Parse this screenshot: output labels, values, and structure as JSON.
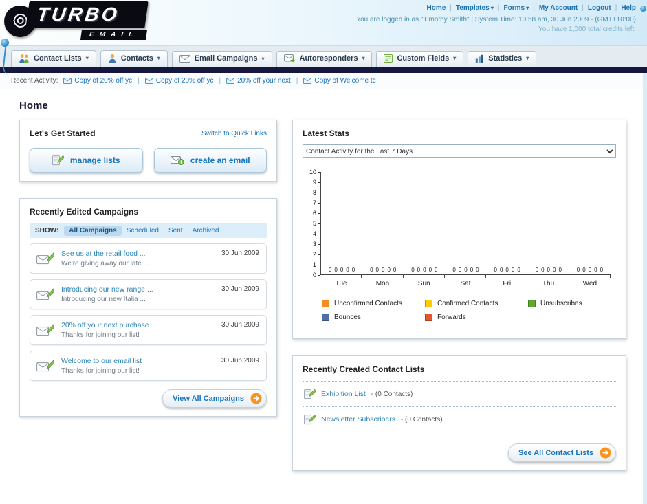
{
  "header": {
    "logo_text": "TURBO",
    "logo_sub": "EMAIL",
    "nav_links": [
      {
        "label": "Home"
      },
      {
        "label": "Templates",
        "caret": true
      },
      {
        "label": "Forms",
        "caret": true
      },
      {
        "label": "My Account"
      },
      {
        "label": "Logout"
      },
      {
        "label": "Help"
      }
    ],
    "login_info": "You are logged in as \"Timothy Smith\" | System Time: 10:58 am, 30 Jun 2009 - (GMT+10:00)",
    "credits": "You have 1,000 total credits left."
  },
  "nav_tabs": [
    {
      "label": "Contact Lists",
      "icon": "people-icon"
    },
    {
      "label": "Contacts",
      "icon": "person-icon"
    },
    {
      "label": "Email Campaigns",
      "icon": "envelope-icon"
    },
    {
      "label": "Autoresponders",
      "icon": "envelope-arrow-icon"
    },
    {
      "label": "Custom Fields",
      "icon": "form-icon"
    },
    {
      "label": "Statistics",
      "icon": "stats-icon"
    }
  ],
  "recent_activity": {
    "label": "Recent Activity:",
    "items": [
      "Copy of 20% off yc",
      "Copy of 20% off yc",
      "20% off your next",
      "Copy of Welcome tc"
    ]
  },
  "page_title": "Home",
  "get_started": {
    "title": "Let's Get Started",
    "switch_link": "Switch to Quick Links",
    "buttons": [
      {
        "label": "manage lists",
        "icon": "pencil-page-icon"
      },
      {
        "label": "create an email",
        "icon": "envelope-plus-icon"
      }
    ]
  },
  "campaigns": {
    "title": "Recently Edited Campaigns",
    "show_label": "SHOW:",
    "tabs": [
      "All Campaigns",
      "Scheduled",
      "Sent",
      "Archived"
    ],
    "items": [
      {
        "title": "See us at the retail food ...",
        "subtitle": "We're giving away our late ...",
        "date": "30 Jun 2009"
      },
      {
        "title": "Introducing our new range ...",
        "subtitle": "Introducing our new Italia ...",
        "date": "30 Jun 2009"
      },
      {
        "title": "20% off your next purchase",
        "subtitle": "Thanks for joining our list!",
        "date": "30 Jun 2009"
      },
      {
        "title": "Welcome to our email list",
        "subtitle": "Thanks for joining our list!",
        "date": "30 Jun 2009"
      }
    ],
    "view_all_label": "View All Campaigns"
  },
  "stats": {
    "title": "Latest Stats",
    "dropdown_value": "Contact Activity for the Last 7 Days"
  },
  "chart_data": {
    "type": "bar",
    "title": "Contact Activity for the Last 7 Days",
    "categories": [
      "Tue",
      "Mon",
      "Sun",
      "Sat",
      "Fri",
      "Thu",
      "Wed"
    ],
    "series": [
      {
        "name": "Unconfirmed Contacts",
        "color": "#f68b1f",
        "values": [
          0,
          0,
          0,
          0,
          0,
          0,
          0
        ]
      },
      {
        "name": "Confirmed Contacts",
        "color": "#ffcb05",
        "values": [
          0,
          0,
          0,
          0,
          0,
          0,
          0
        ]
      },
      {
        "name": "Unsubscribes",
        "color": "#61a532",
        "values": [
          0,
          0,
          0,
          0,
          0,
          0,
          0
        ]
      },
      {
        "name": "Bounces",
        "color": "#4f6fa5",
        "values": [
          0,
          0,
          0,
          0,
          0,
          0,
          0
        ]
      },
      {
        "name": "Forwards",
        "color": "#e4572e",
        "values": [
          0,
          0,
          0,
          0,
          0,
          0,
          0
        ]
      }
    ],
    "ylim": [
      0,
      10
    ],
    "yticks": [
      0,
      1,
      2,
      3,
      4,
      5,
      6,
      7,
      8,
      9,
      10
    ],
    "grid": false,
    "legend_position": "bottom"
  },
  "contact_lists": {
    "title": "Recently Created Contact Lists",
    "items": [
      {
        "name": "Exhibition List",
        "count": "(0 Contacts)"
      },
      {
        "name": "Newsletter Subscribers",
        "count": "(0 Contacts)"
      }
    ],
    "see_all_label": "See All Contact Lists"
  },
  "colors": {
    "accent_orange": "#f7941d",
    "link_blue": "#1b75bb",
    "dark_bar": "#15173c",
    "header_blue": "#d2eaf8"
  }
}
